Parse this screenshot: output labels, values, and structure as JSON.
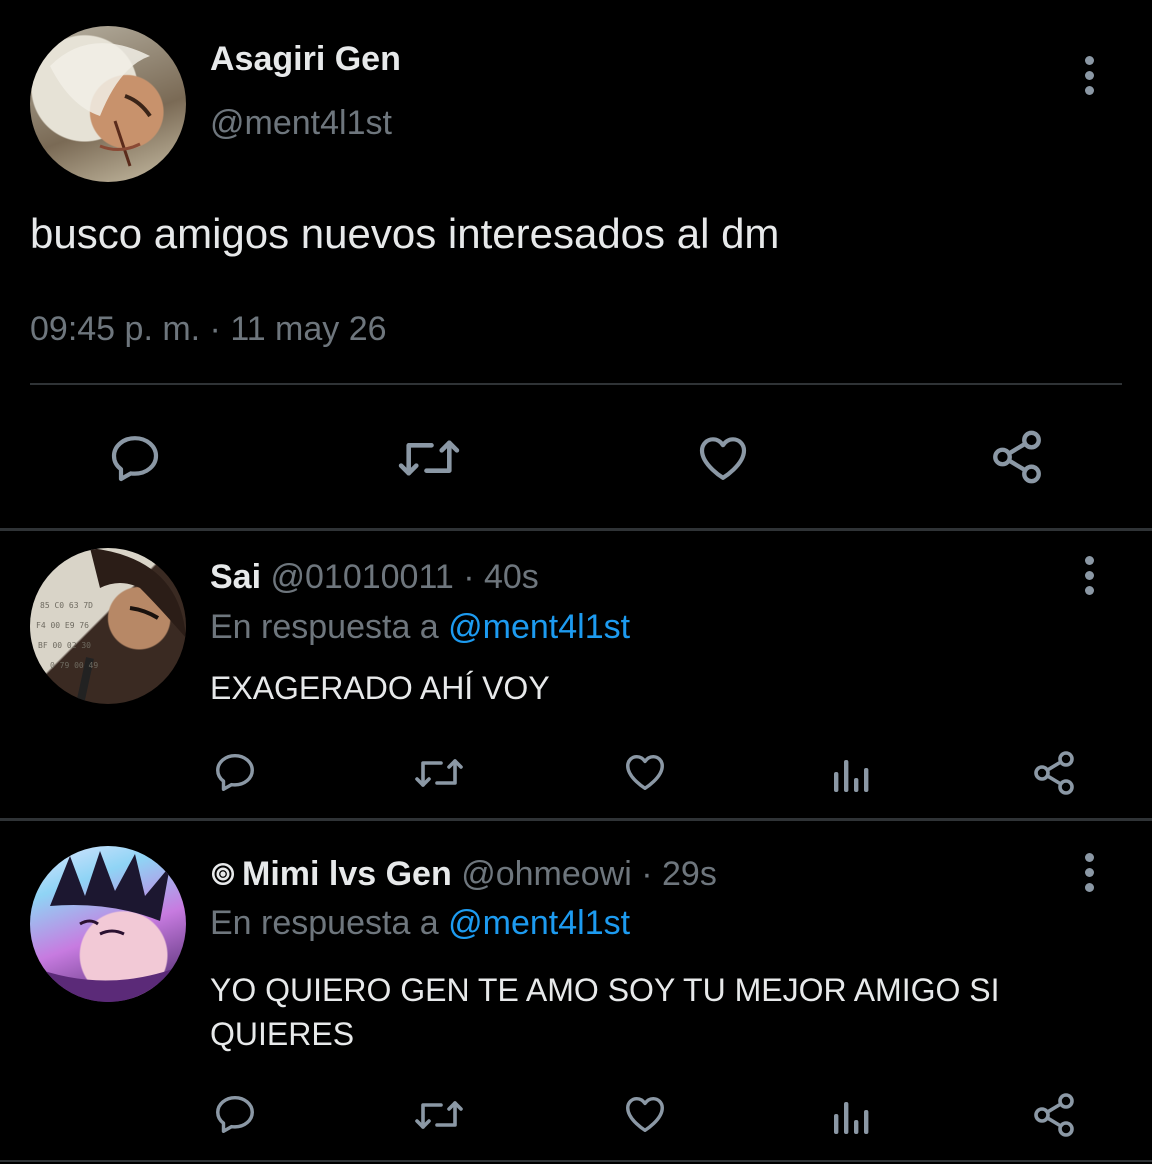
{
  "main_tweet": {
    "author_name": "Asagiri Gen",
    "handle": "@ment4l1st",
    "text": "busco amigos nuevos interesados al dm",
    "timestamp": "09:45 p. m. · 11 may 26",
    "actions": [
      "reply-icon",
      "retweet-icon",
      "like-icon",
      "share-icon"
    ]
  },
  "replies": [
    {
      "author_name": "Sai",
      "handle": "@01010011",
      "time": "· 40s",
      "reply_prefix": "En respuesta a",
      "reply_to": "@ment4l1st",
      "text": "EXAGERADO AHÍ VOY"
    },
    {
      "author_name": "Mimi lvs Gen",
      "handle": "@ohmeowi",
      "time": "· 29s",
      "reply_prefix": "En respuesta a",
      "reply_to": "@ment4l1st",
      "text": "YO QUIERO GEN TE AMO SOY TU MEJOR AMIGO SI QUIERES"
    }
  ],
  "colors": {
    "background": "#000000",
    "text": "#e7e9ea",
    "muted": "#6e767d",
    "link": "#1d9bf0",
    "icon": "#8b98a5",
    "divider": "#2f3336"
  }
}
